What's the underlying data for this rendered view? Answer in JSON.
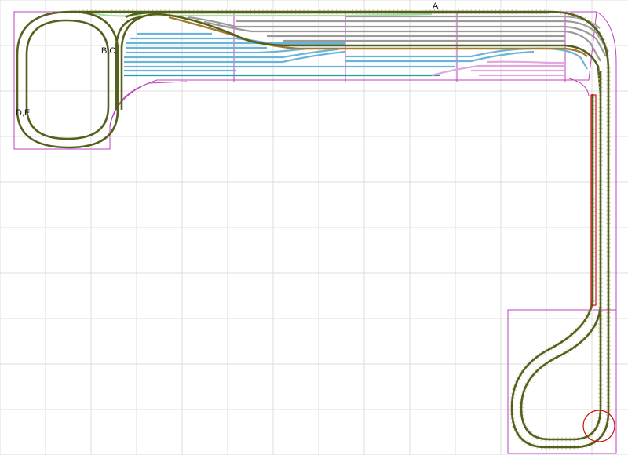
{
  "labels": {
    "a": "A",
    "bc": "B,C",
    "de": "D,E"
  },
  "colors": {
    "background": "#ffffff",
    "grid": "#dcdcdc",
    "module_outline": "#c040c0",
    "track_main_rail": "#55601c",
    "track_main_ties": "#d8d8b8",
    "track_grey": "#9a9a9a",
    "track_blue": "#6ab4d8",
    "track_teal": "#20a0a0",
    "track_green_light": "#a8dca8",
    "track_brown": "#a87a30",
    "track_pink": "#e0a8dc",
    "highlight_red": "#cc1111"
  },
  "icons": {
    "turntable": "circle-marker",
    "siding_box": "red-rectangle"
  }
}
